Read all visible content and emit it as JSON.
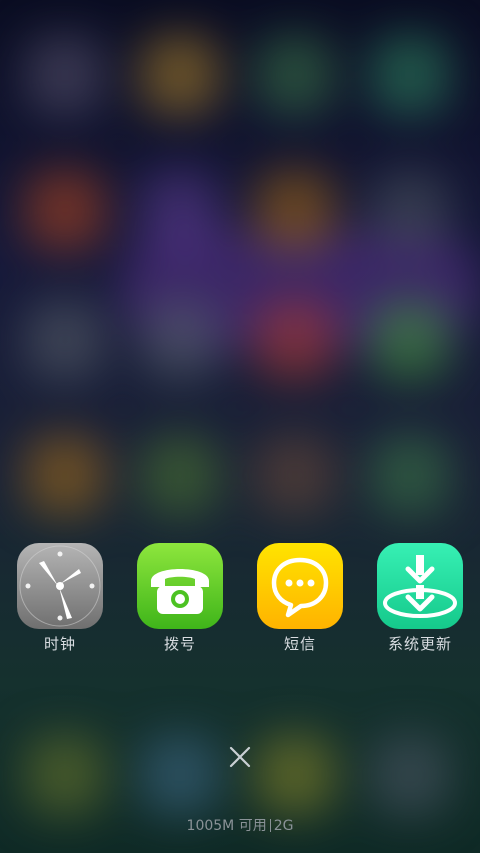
{
  "background": {
    "blurred_icon_colors": [
      "#5a5470",
      "#b0852a",
      "#3d7a4a",
      "#2f8a62",
      "#b6471e",
      "#5d3c93",
      "#a86a12",
      "#4d5560",
      "#59606c",
      "#55636c",
      "#b23a2e",
      "#3f9a39",
      "#a8701a",
      "#4c7a32",
      "#6b4a38",
      "#3c7c49",
      "#6d7a2c",
      "#3f6c8a",
      "#8c8a28",
      "#4f5a68"
    ]
  },
  "dock": {
    "apps": [
      {
        "label": "时钟",
        "icon": "clock-icon",
        "color": "#8a8a8a"
      },
      {
        "label": "拨号",
        "icon": "phone-icon",
        "color": "#5ccc25"
      },
      {
        "label": "短信",
        "icon": "message-icon",
        "color": "#ffcc00"
      },
      {
        "label": "系统更新",
        "icon": "system-update-icon",
        "color": "#22dc9e"
      }
    ]
  },
  "close_button": {
    "icon": "close-icon"
  },
  "status": {
    "memory": "1005M 可用",
    "network": "2G"
  }
}
